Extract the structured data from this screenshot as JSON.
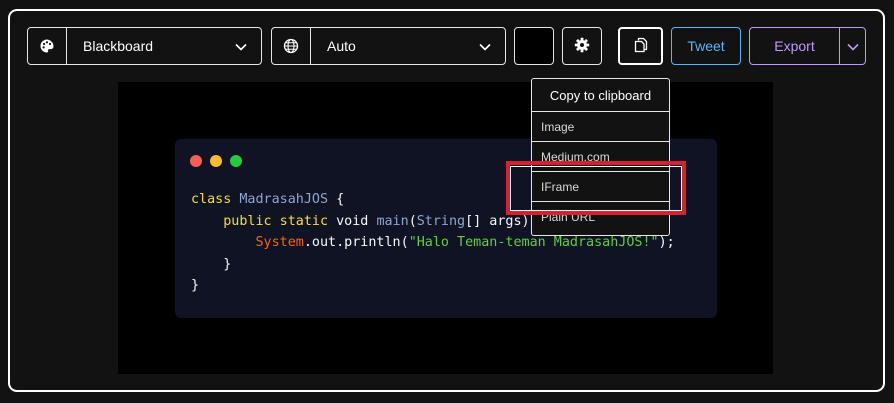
{
  "toolbar": {
    "theme_select": {
      "icon": "palette-icon",
      "value": "Blackboard"
    },
    "language_select": {
      "icon": "globe-icon",
      "value": "Auto"
    },
    "background_color": "#000000",
    "settings_icon": "gear-icon",
    "copy_icon": "copy-icon",
    "tweet_label": "Tweet",
    "export_label": "Export",
    "accent": {
      "tweet": "#57b5f9",
      "export": "#c198fb"
    }
  },
  "copy_menu": {
    "header": "Copy to clipboard",
    "items": [
      "Image",
      "Medium.com",
      "IFrame",
      "Plain URL"
    ],
    "highlighted_item": "IFrame"
  },
  "code_window": {
    "dots": [
      "#ff5f56",
      "#ffbd2e",
      "#27c93f"
    ],
    "lines": [
      [
        {
          "t": "class ",
          "c": "kw"
        },
        {
          "t": "MadrasahJOS",
          "c": "cls"
        },
        {
          "t": " {",
          "c": ""
        }
      ],
      [
        {
          "t": "    ",
          "c": ""
        },
        {
          "t": "public static ",
          "c": "kw"
        },
        {
          "t": "void ",
          "c": ""
        },
        {
          "t": "main",
          "c": "fn"
        },
        {
          "t": "(",
          "c": ""
        },
        {
          "t": "String",
          "c": "cls"
        },
        {
          "t": "[] args) {",
          "c": ""
        }
      ],
      [
        {
          "t": "        ",
          "c": ""
        },
        {
          "t": "System",
          "c": "sys"
        },
        {
          "t": ".out.println(",
          "c": ""
        },
        {
          "t": "\"Halo Teman-teman MadrasahJOS!\"",
          "c": "str"
        },
        {
          "t": ");",
          "c": ""
        }
      ],
      [
        {
          "t": "    }",
          "c": ""
        }
      ],
      [
        {
          "t": "}",
          "c": ""
        }
      ]
    ]
  }
}
